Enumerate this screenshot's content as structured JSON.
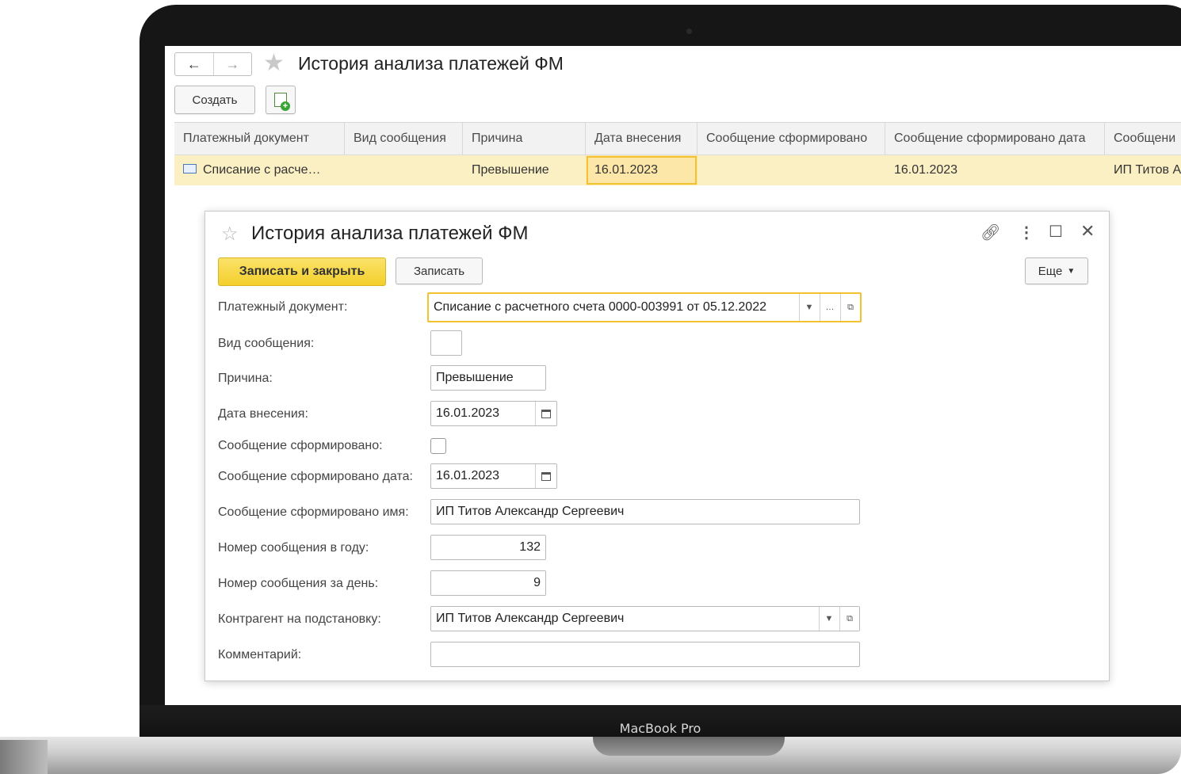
{
  "device_label": "MacBook Pro",
  "list": {
    "title": "История анализа платежей ФМ",
    "nav_back": "←",
    "nav_forward": "→",
    "create_label": "Создать",
    "columns": [
      "Платежный документ",
      "Вид сообщения",
      "Причина",
      "Дата внесения",
      "Сообщение сформировано",
      "Сообщение сформировано дата",
      "Сообщени"
    ],
    "row": [
      "Списание с расче…",
      "",
      "Превышение",
      "16.01.2023",
      "",
      "16.01.2023",
      "ИП Титов А"
    ]
  },
  "form": {
    "title": "История анализа платежей ФМ",
    "save_close_label": "Записать и закрыть",
    "save_label": "Записать",
    "more_label": "Еще",
    "fields": {
      "payment_doc": {
        "label": "Платежный документ:",
        "value": "Списание с расчетного счета 0000-003991 от 05.12.2022"
      },
      "msg_type": {
        "label": "Вид сообщения:",
        "value": ""
      },
      "reason": {
        "label": "Причина:",
        "value": "Превышение"
      },
      "entry_date": {
        "label": "Дата внесения:",
        "value": "16.01.2023"
      },
      "msg_formed": {
        "label": "Сообщение сформировано:",
        "checked": false
      },
      "msg_formed_date": {
        "label": "Сообщение сформировано дата:",
        "value": "16.01.2023"
      },
      "msg_formed_name": {
        "label": "Сообщение сформировано имя:",
        "value": "ИП Титов Александр Сергеевич"
      },
      "msg_num_year": {
        "label": "Номер сообщения в году:",
        "value": "132"
      },
      "msg_num_day": {
        "label": "Номер сообщения за день:",
        "value": "9"
      },
      "counterparty": {
        "label": "Контрагент на подстановку:",
        "value": "ИП Титов Александр Сергеевич"
      },
      "comment": {
        "label": "Комментарий:",
        "value": ""
      }
    }
  },
  "colors": {
    "accent_yellow": "#f4cf2b",
    "selected_row": "#fbf0c4",
    "focus_border": "#f2c230"
  }
}
